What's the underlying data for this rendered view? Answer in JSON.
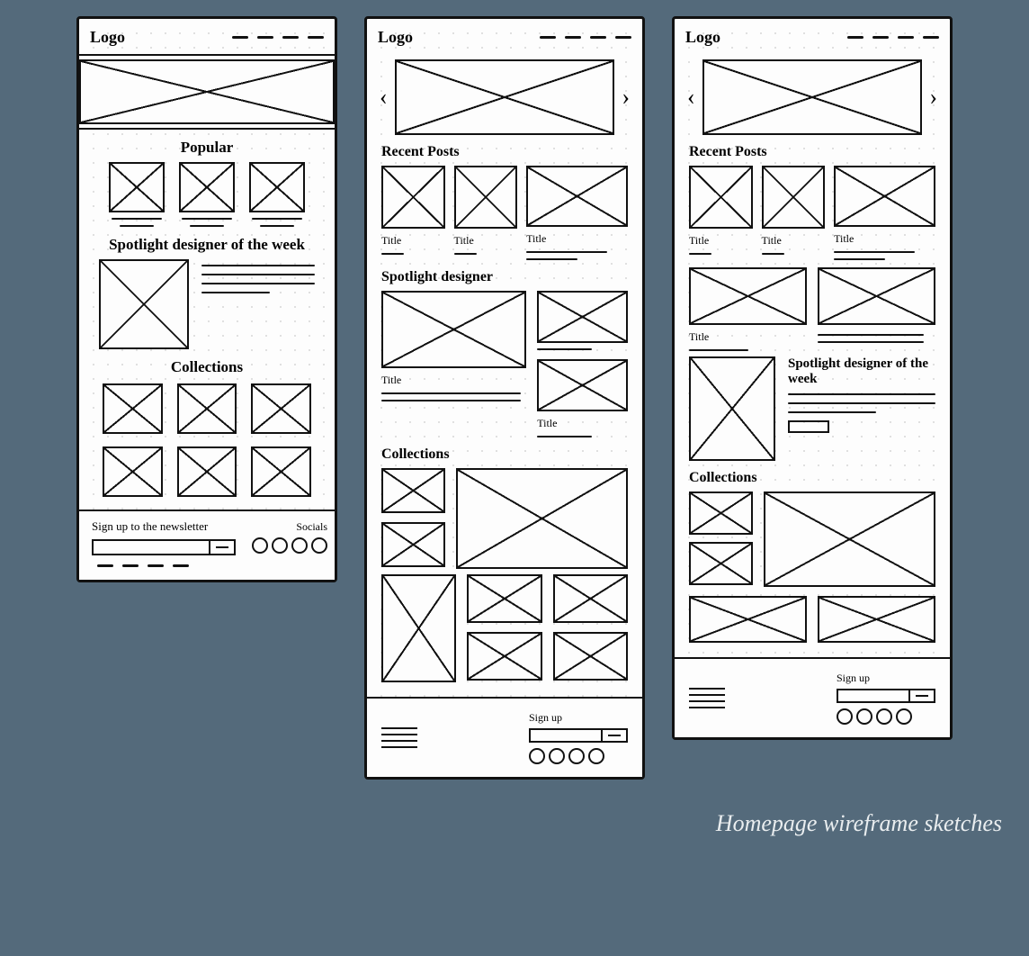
{
  "caption": "Homepage wireframe sketches",
  "common": {
    "logo": "Logo",
    "title_label": "Title",
    "signup_label": "Sign up"
  },
  "frame_a": {
    "section_popular": "Popular",
    "section_spotlight": "Spotlight designer of the week",
    "section_collections": "Collections",
    "newsletter_text": "Sign up to the newsletter",
    "socials_label": "Socials"
  },
  "frame_b": {
    "section_recent": "Recent Posts",
    "section_spotlight": "Spotlight designer",
    "section_collections": "Collections"
  },
  "frame_c": {
    "section_recent": "Recent Posts",
    "section_spotlight": "Spotlight designer of the week",
    "section_collections": "Collections"
  }
}
